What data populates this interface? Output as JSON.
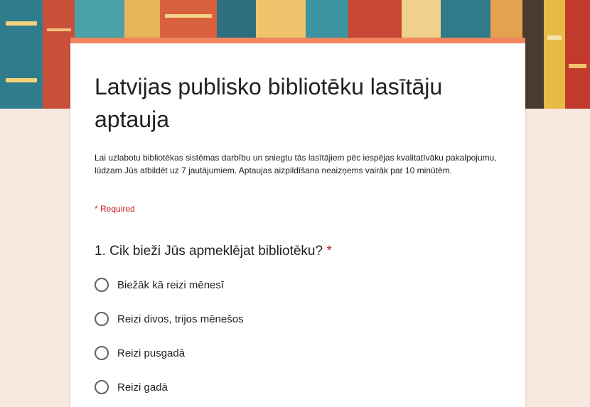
{
  "form": {
    "title": "Latvijas publisko bibliotēku lasītāju aptauja",
    "description": "Lai uzlabotu bibliotēkas sistēmas darbību un sniegtu tās lasītājiem pēc iespējas kvalitatīvāku pakalpojumu, lūdzam Jūs atbildēt uz 7 jautājumiem. Aptaujas aizpildīšana neaizņems vairāk par 10 minūtēm.",
    "required_note": "* Required",
    "accent_color": "#f0855f",
    "background_color": "#f9e8e0"
  },
  "question1": {
    "text": "1. Cik bieži Jūs apmeklējat bibliotēku?",
    "required_mark": "*",
    "options": [
      {
        "label": "Biežāk kā reizi mēnesī"
      },
      {
        "label": "Reizi divos, trijos mēnešos"
      },
      {
        "label": "Reizi pusgadā"
      },
      {
        "label": "Reizi gadā"
      }
    ]
  }
}
